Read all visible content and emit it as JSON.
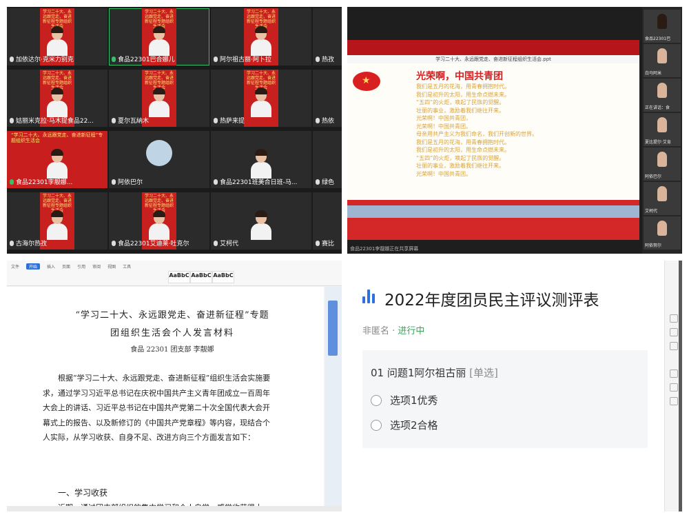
{
  "meeting": {
    "tile_banner": "学习二十大、永远跟党走、奋进新征程专题组织生活会",
    "wide_banner": "“学习二十大、永远跟党走、奋进新征程”专题组织生活会",
    "participants": [
      {
        "name": "加依达尔·克米力别克"
      },
      {
        "name": "食品22301巴合娜儿"
      },
      {
        "name": "阿尔祖古丽·阿卜拉"
      },
      {
        "name": "热孜"
      },
      {
        "name": "姑丽米克拉·马木提食品22..."
      },
      {
        "name": "夏尔瓦納木"
      },
      {
        "name": "热萨来提"
      },
      {
        "name": "热依"
      },
      {
        "name": "食品22301李靓娜..."
      },
      {
        "name": "阿依巴尔"
      },
      {
        "name": "食品22301班美合日班-马..."
      },
      {
        "name": "绿色"
      },
      {
        "name": "古海尔热孜"
      },
      {
        "name": "食品22301艾迪莱·吐克尔"
      },
      {
        "name": "艾柯代"
      },
      {
        "name": "赛比"
      }
    ]
  },
  "presentation": {
    "file_name": "学习二十大、永远跟党走、奋进新征程组织生活会.ppt",
    "heading": "光荣啊，中国共青团",
    "lines": [
      "我们是五月的花海，用青春拥抱时代。",
      "我们是初升的太阳，用生命点燃未来。",
      "“五四”的火炬，唤起了民族的觉醒。",
      "壮丽的事业，激励着我们继往开来。",
      "光荣啊！中国共青团，",
      "光荣啊！中国共青团。",
      "母亲用共产主义为我们命名，我们开创新的世界。",
      "我们是五月的花海，用青春拥抱时代。",
      "我们是初升的太阳，用生命点燃未来。",
      "“五四”的火炬，唤起了民族的觉醒。",
      "壮丽的事业，激励着我们继往开来。",
      "光荣啊！中国共青团。"
    ],
    "caption": "食品22301李靓娜正在共享屏幕",
    "sidebar": [
      {
        "name": "食品22301巴"
      },
      {
        "name": "白马阿米"
      },
      {
        "name": "正在讲话：食"
      },
      {
        "name": "夏比提尔·艾肯"
      },
      {
        "name": "阿依巴尔"
      },
      {
        "name": "艾柯代"
      },
      {
        "name": "阿依努尔"
      }
    ]
  },
  "document": {
    "tabs": [
      "文件",
      "开始",
      "插入",
      "页面",
      "引用",
      "审阅",
      "视图",
      "工具"
    ],
    "active_tab": "开始",
    "styles": [
      "AaBbC",
      "AaBbC",
      "AaBbC"
    ],
    "title_line1": "“学习二十大、永远跟党走、奋进新征程”专题",
    "title_line2": "团组织生活会个人发言材料",
    "author": "食品 22301 团支部 李靓娜",
    "body": "根据“学习二十大、永远跟党走、奋进新征程”组织生活会实施要求，通过学习习近平总书记在庆祝中国共产主义青年团成立一百周年大会上的讲话、习近平总书记在中国共产党第二十次全国代表大会开幕式上的报告、以及新修订的《中国共产党章程》等内容，现结合个人实际，从学习收获、自身不足、改进方向三个方面发言如下：",
    "heading1": "一、学习收获",
    "body2": "近期，通过团支部组织的集中学习和个人自学，感觉收获很大，受益匪浅。一是在学习上：我严格要求自己，踏实认真、勤"
  },
  "form": {
    "title": "2022年度团员民主评议测评表",
    "anon": "非匿名 · ",
    "status": "进行中",
    "question_label": "01  问题1阿尔祖古丽 ",
    "question_type": "[单选]",
    "options": [
      "选项1优秀",
      "选项2合格"
    ],
    "accent": "#2f6fe0",
    "status_color": "#3aa45b"
  }
}
